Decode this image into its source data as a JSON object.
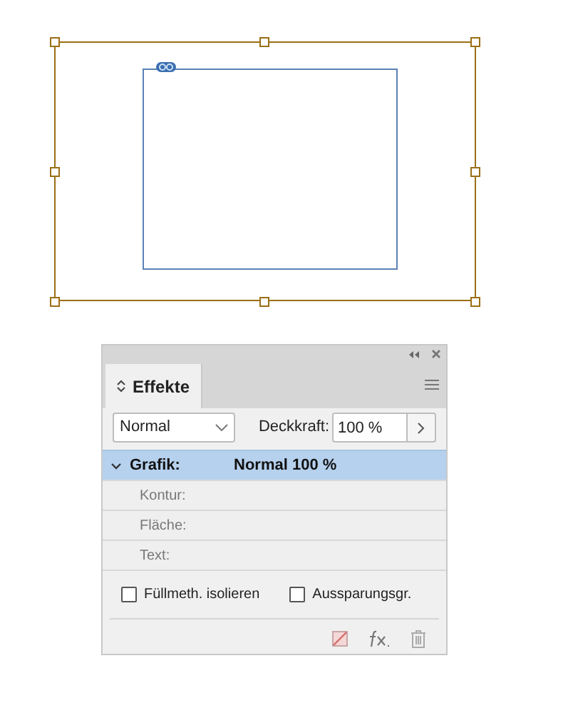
{
  "panel": {
    "tabs": [
      {
        "label": "Effekte",
        "selected": true
      }
    ],
    "blend_mode": {
      "value": "Normal"
    },
    "opacity": {
      "label": "Deckkraft:",
      "value": "100 %"
    },
    "rows": [
      {
        "label": "Grafik:",
        "value": "Normal 100 %",
        "selected": true,
        "expanded": true
      },
      {
        "label": "Kontur:",
        "selected": false
      },
      {
        "label": "Fläche:",
        "selected": false
      },
      {
        "label": "Text:",
        "selected": false
      }
    ],
    "options": [
      {
        "label": "Füllmeth. isolieren",
        "checked": false
      },
      {
        "label": "Aussparungsgr.",
        "checked": false
      }
    ]
  }
}
